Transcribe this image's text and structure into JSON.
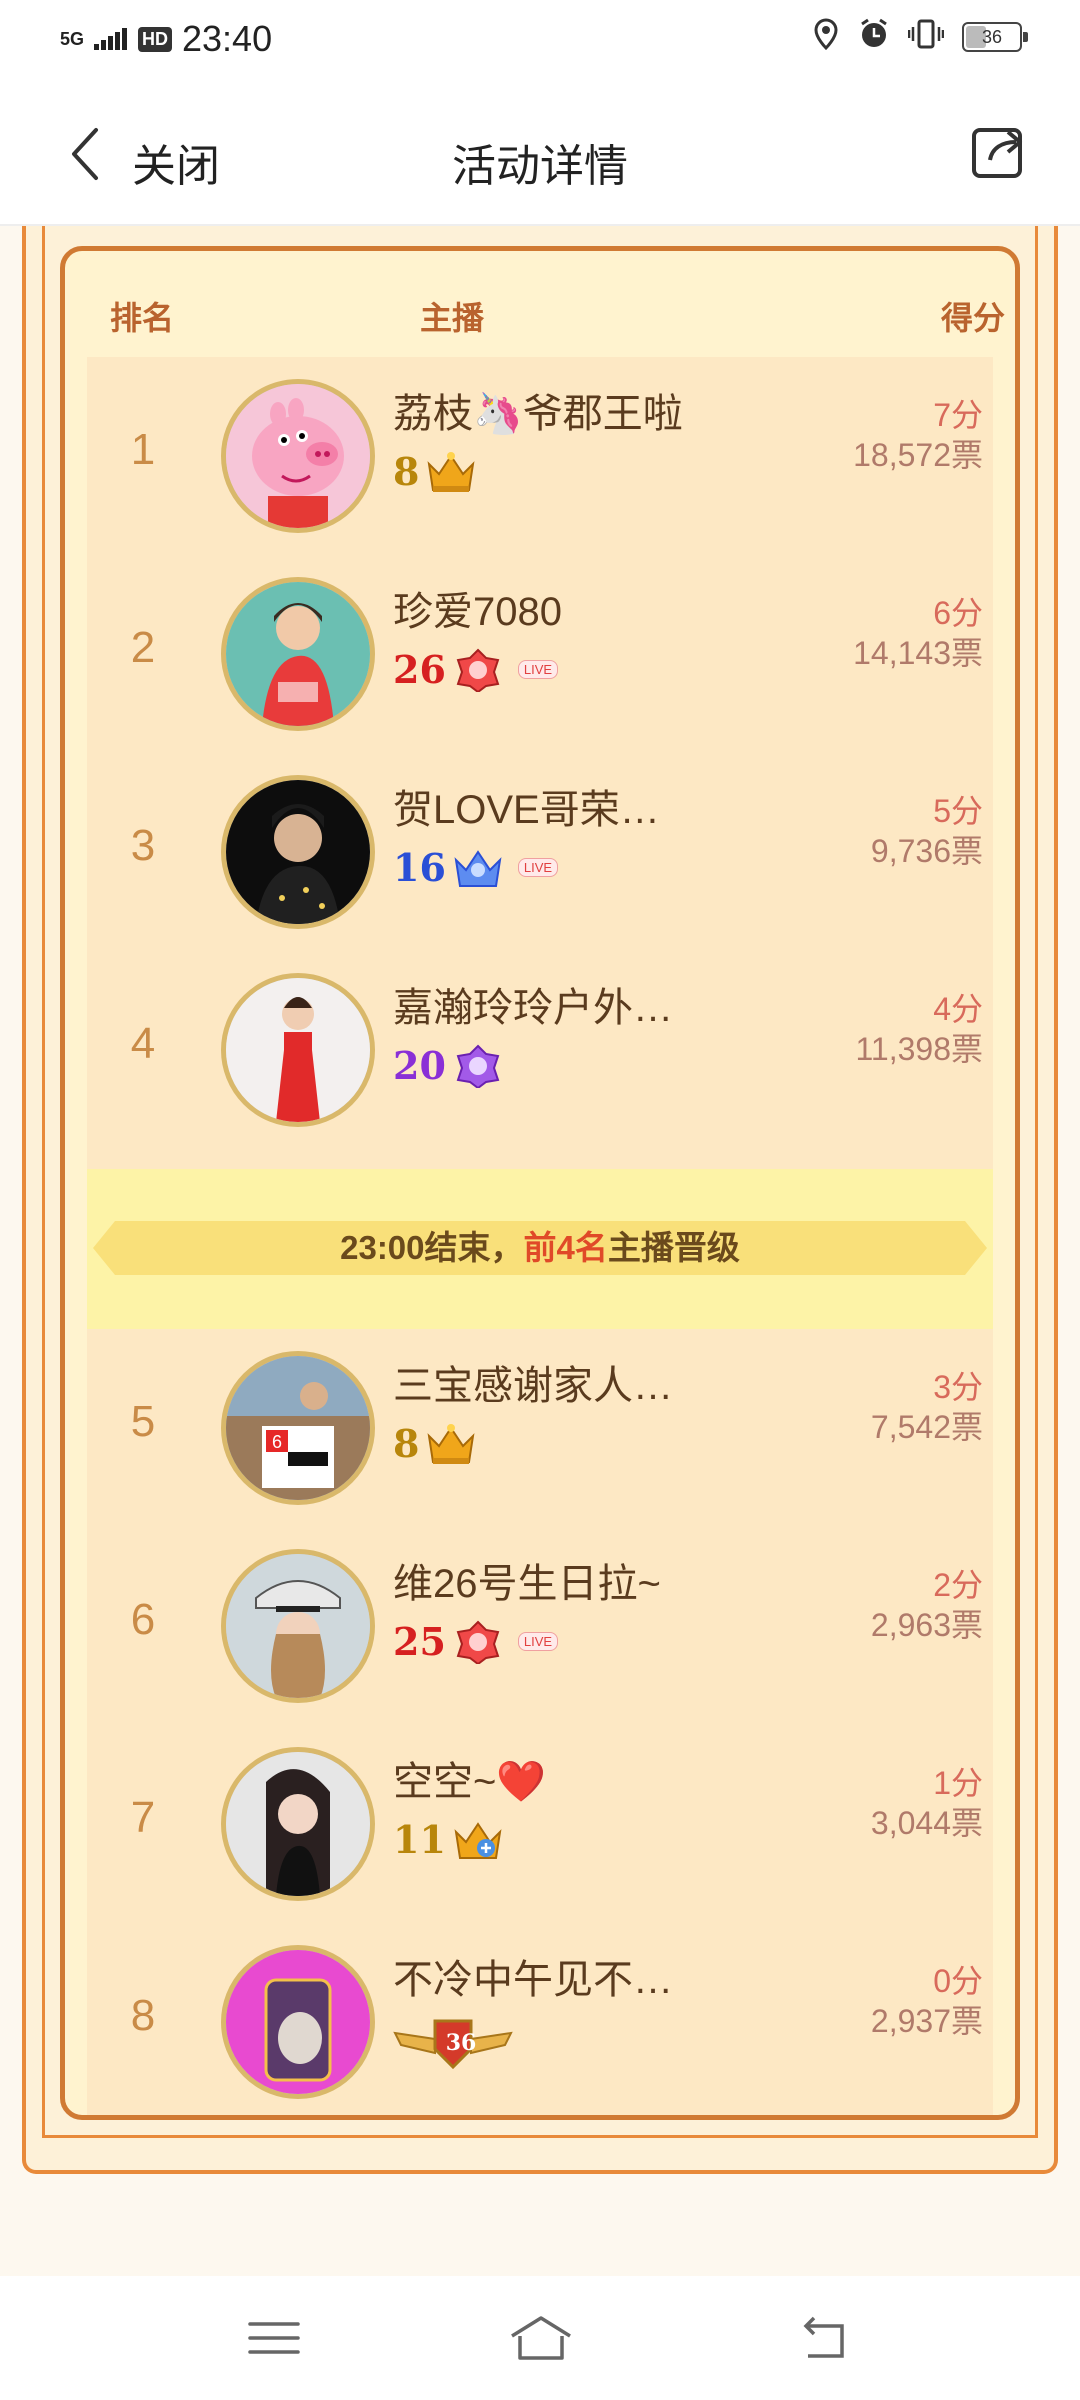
{
  "status_bar": {
    "network": "5G",
    "hd": "HD",
    "time": "23:40",
    "battery": "36"
  },
  "header": {
    "close_label": "关闭",
    "title": "活动详情"
  },
  "table": {
    "columns": {
      "rank": "排名",
      "host": "主播",
      "score": "得分"
    },
    "rows": [
      {
        "rank": "1",
        "name": "荔枝🦄爷郡王啦",
        "level": "8",
        "level_color": "#b8860b",
        "badge": "crown-icon",
        "live": "",
        "score": "7分",
        "votes": "18,572票"
      },
      {
        "rank": "2",
        "name": "珍爱7080",
        "level": "26",
        "level_color": "#d62020",
        "badge": "red-gem-badge-icon",
        "live": "LIVE",
        "score": "6分",
        "votes": "14,143票"
      },
      {
        "rank": "3",
        "name": "贺LOVE哥荣…",
        "level": "16",
        "level_color": "#2a4fd6",
        "badge": "blue-crown-icon",
        "live": "LIVE",
        "score": "5分",
        "votes": "9,736票"
      },
      {
        "rank": "4",
        "name": "嘉瀚玲玲户外…",
        "level": "20",
        "level_color": "#8a2fd6",
        "badge": "purple-gem-badge-icon",
        "live": "",
        "score": "4分",
        "votes": "11,398票"
      },
      {
        "rank": "5",
        "name": "三宝感谢家人…",
        "level": "8",
        "level_color": "#b8860b",
        "badge": "crown-icon",
        "live": "",
        "score": "3分",
        "votes": "7,542票"
      },
      {
        "rank": "6",
        "name": "维26号生日拉~",
        "level": "25",
        "level_color": "#d62020",
        "badge": "red-gem-badge-icon",
        "live": "LIVE",
        "score": "2分",
        "votes": "2,963票"
      },
      {
        "rank": "7",
        "name": "空空~❤️",
        "level": "11",
        "level_color": "#b8860b",
        "badge": "plus-crown-icon",
        "live": "",
        "score": "1分",
        "votes": "3,044票"
      },
      {
        "rank": "8",
        "name": "不冷中午见不…",
        "level": "36",
        "level_color": "#c0392b",
        "badge": "winged-shield-badge-icon",
        "live": "",
        "score": "0分",
        "votes": "2,937票"
      }
    ]
  },
  "banner": {
    "prefix": "23:00结束，",
    "highlight": "前4名",
    "suffix": "主播晋级"
  },
  "colors": {
    "accent": "#e88a3a",
    "board_bg": "#fde8c4",
    "score": "#d86a5b"
  }
}
